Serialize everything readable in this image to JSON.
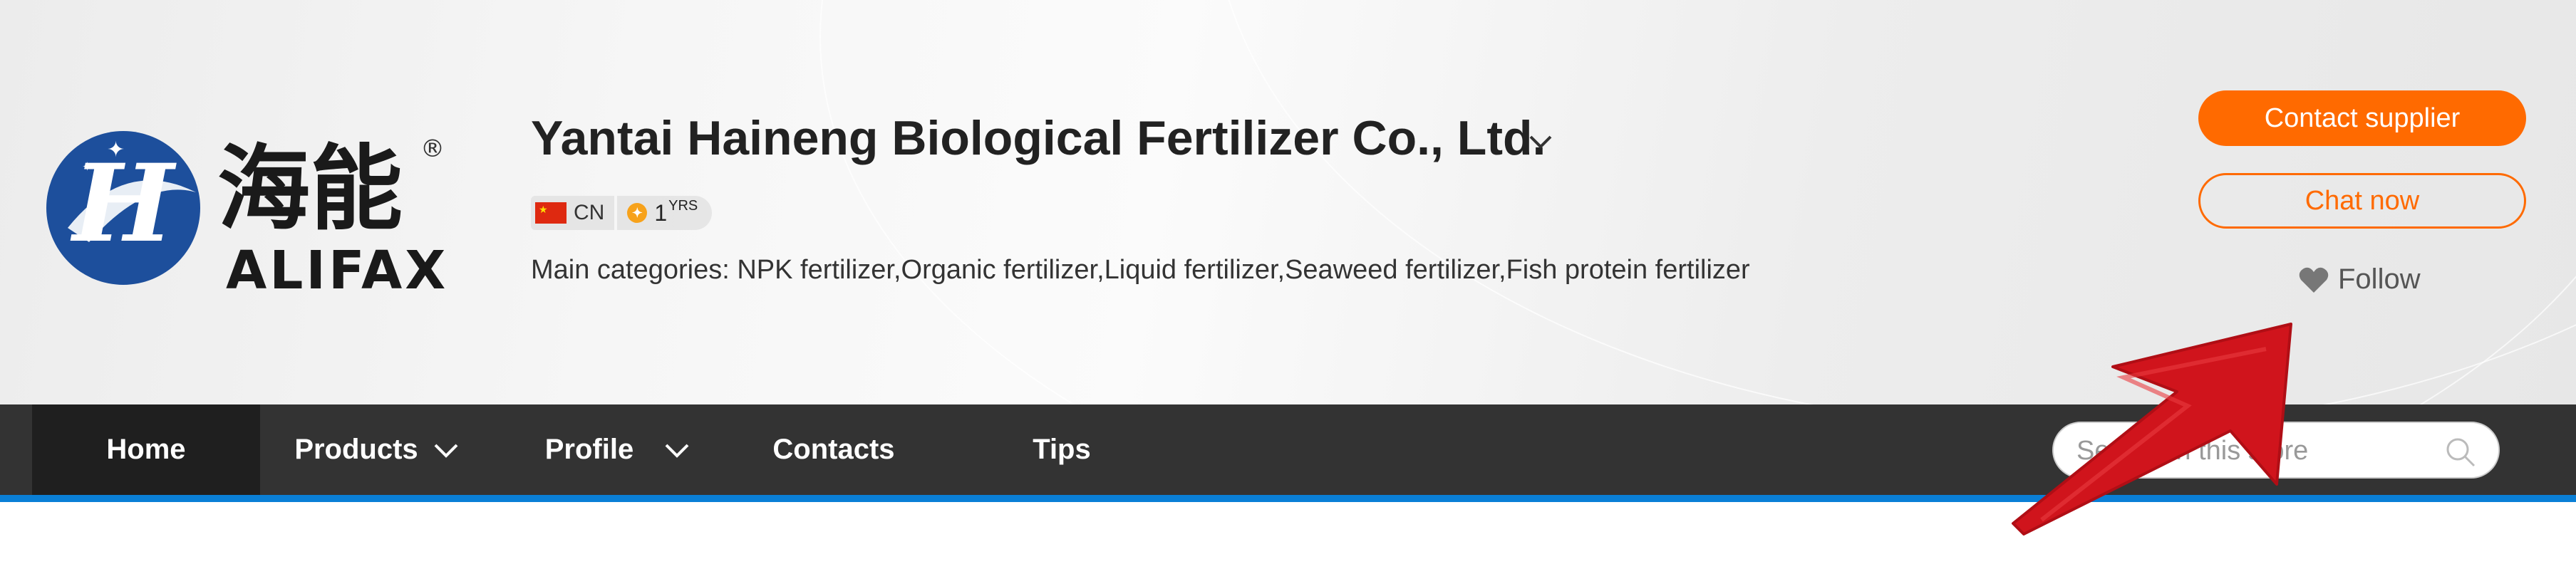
{
  "store": {
    "company_name": "Yantai Haineng Biological Fertilizer Co., Ltd.",
    "country": "CN",
    "years_number": "1",
    "years_unit": "YRS",
    "main_categories": "Main categories: NPK fertilizer,Organic fertilizer,Liquid fertilizer,Seaweed fertilizer,Fish protein fertilizer"
  },
  "logo": {
    "chinese": "海能",
    "latin": "ALIFAX",
    "registered": "®"
  },
  "actions": {
    "contact_supplier": "Contact supplier",
    "chat_now": "Chat now",
    "follow": "Follow"
  },
  "nav": {
    "items": [
      {
        "label": "Home",
        "active": true,
        "dropdown": false
      },
      {
        "label": "Products",
        "active": false,
        "dropdown": true
      },
      {
        "label": "Profile",
        "active": false,
        "dropdown": true
      },
      {
        "label": "Contacts",
        "active": false,
        "dropdown": false
      },
      {
        "label": "Tips",
        "active": false,
        "dropdown": false
      }
    ],
    "search_placeholder": "Search in this store"
  },
  "colors": {
    "accent": "#ff6a00",
    "nav_bg": "#333333",
    "nav_active_bg": "#1f1f1f",
    "nav_underline": "#0a7fd6",
    "logo_blue": "#1d4f9c",
    "annotation_arrow": "#d0141c"
  },
  "icons": {
    "name_dropdown": "chevron-down-icon",
    "follow": "heart-icon",
    "search": "search-icon",
    "country": "china-flag-icon",
    "years": "gold-coin-icon"
  }
}
